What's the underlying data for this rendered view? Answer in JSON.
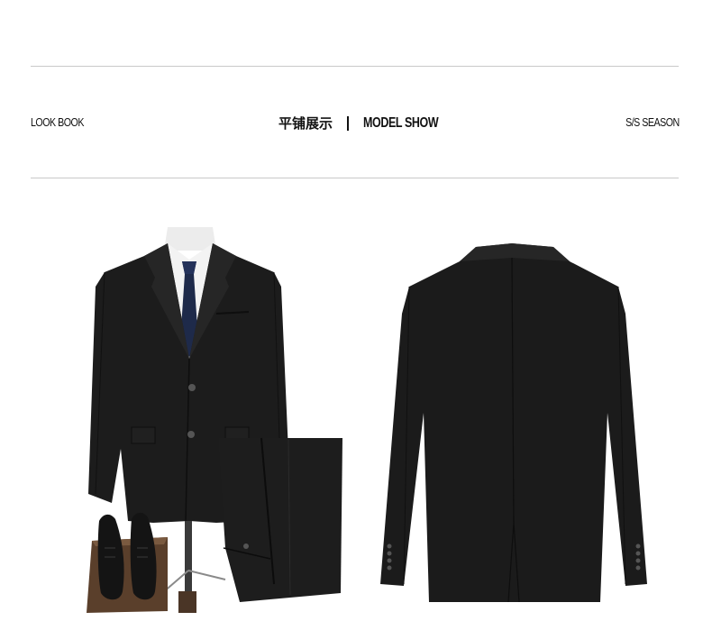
{
  "header": {
    "left_label": "LOOK BOOK",
    "title_cn": "平铺展示",
    "title_en": "MODEL SHOW",
    "right_label": "S/S SEASON"
  },
  "images": {
    "front": "front-suit-on-mannequin-with-trousers-and-shoes",
    "back": "back-view-of-black-jacket"
  },
  "colors": {
    "suit": "#1c1c1c",
    "tie": "#1e2a4a",
    "shirt": "#f2f2f2",
    "rule": "#c9c9c9"
  }
}
